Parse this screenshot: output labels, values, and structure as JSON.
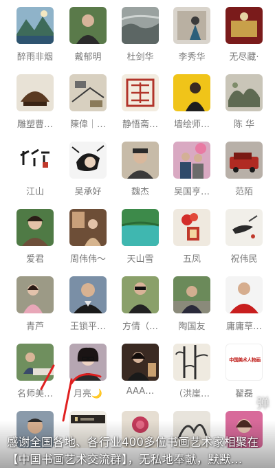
{
  "members": [
    {
      "name": "醉雨非烟",
      "icon": "landscape-avatar-icon"
    },
    {
      "name": "戴郁明",
      "icon": "man-portrait-avatar-icon"
    },
    {
      "name": "杜剑华",
      "icon": "ink-painting-avatar-icon"
    },
    {
      "name": "李秀华",
      "icon": "painting-avatar-icon"
    },
    {
      "name": "无尽藏·",
      "icon": "red-decor-avatar-icon"
    },
    {
      "name": "雕塑曹…",
      "icon": "sculpture-avatar-icon"
    },
    {
      "name": "陳偉｜…",
      "icon": "sketch-avatar-icon"
    },
    {
      "name": "静悟斋…",
      "icon": "seal-avatar-icon"
    },
    {
      "name": "墙绘师…",
      "icon": "yellow-portrait-avatar-icon"
    },
    {
      "name": "陈 华",
      "icon": "rock-painting-avatar-icon"
    },
    {
      "name": "江山",
      "icon": "calligraphy-logo-avatar-icon"
    },
    {
      "name": "吴承好",
      "icon": "cartoon-avatar-icon"
    },
    {
      "name": "魏杰",
      "icon": "man-cap-avatar-icon"
    },
    {
      "name": "吴国亨…",
      "icon": "couple-avatar-icon"
    },
    {
      "name": "范陌",
      "icon": "car-avatar-icon"
    },
    {
      "name": "爱君",
      "icon": "woman-avatar-icon"
    },
    {
      "name": "周伟伟～",
      "icon": "interior-avatar-icon"
    },
    {
      "name": "天山雪",
      "icon": "lake-avatar-icon"
    },
    {
      "name": "五凤",
      "icon": "red-flower-avatar-icon"
    },
    {
      "name": "祝伟民",
      "icon": "ink-bird-avatar-icon"
    },
    {
      "name": "青芦",
      "icon": "woman-pink-avatar-icon"
    },
    {
      "name": "王锁平…",
      "icon": "man-shirt-avatar-icon"
    },
    {
      "name": "方倩（…",
      "icon": "woman-sunglasses-avatar-icon"
    },
    {
      "name": "陶国友",
      "icon": "man-outdoor-avatar-icon"
    },
    {
      "name": "庸庸草…",
      "icon": "man-red-avatar-icon"
    },
    {
      "name": "名师美…",
      "icon": "man-desk-avatar-icon"
    },
    {
      "name": "月亮🌙",
      "icon": "woman-glasses-avatar-icon"
    },
    {
      "name": "AAA…",
      "icon": "woman-dark-avatar-icon"
    },
    {
      "name": "（洪崖…",
      "icon": "bamboo-avatar-icon"
    },
    {
      "name": "翟磊",
      "icon": "logo-text-avatar-icon"
    },
    {
      "name": "",
      "icon": "man-face-avatar-icon"
    },
    {
      "name": "",
      "icon": "dark-banner-avatar-icon"
    },
    {
      "name": "",
      "icon": "peony-avatar-icon"
    },
    {
      "name": "",
      "icon": "tree-avatar-icon"
    },
    {
      "name": "",
      "icon": "woman-pink-bg-avatar-icon"
    }
  ],
  "logo_text": "中国美术人物画",
  "danmu": {
    "toggle_label": "弹",
    "line1": "感谢全国各地、各行业400多位书画艺术家相聚在",
    "line2": "【中国书画艺术交流群】，无私地奉献，默默…"
  },
  "colors": {
    "name_text": "#7a7a7a",
    "annotation_red": "#e02020"
  }
}
